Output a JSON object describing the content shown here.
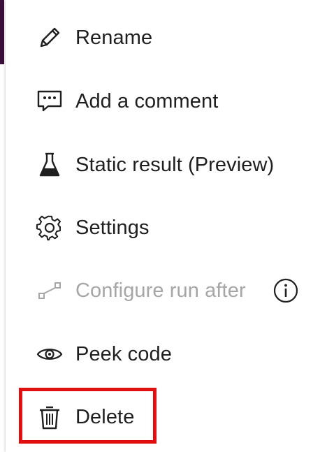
{
  "menu": {
    "items": [
      {
        "label": "Rename",
        "icon": "pencil-icon",
        "enabled": true
      },
      {
        "label": "Add a comment",
        "icon": "comment-icon",
        "enabled": true
      },
      {
        "label": "Static result (Preview)",
        "icon": "flask-icon",
        "enabled": true
      },
      {
        "label": "Settings",
        "icon": "gear-icon",
        "enabled": true
      },
      {
        "label": "Configure run after",
        "icon": "run-after-icon",
        "enabled": false,
        "info_icon": "info-icon"
      },
      {
        "label": "Peek code",
        "icon": "eye-icon",
        "enabled": true
      },
      {
        "label": "Delete",
        "icon": "trash-icon",
        "enabled": true,
        "highlighted": true
      }
    ]
  },
  "colors": {
    "text": "#1f1f1f",
    "disabled_text": "#a6a6a6",
    "highlight": "#e01010",
    "accent_strip": "#3b0f3b"
  }
}
